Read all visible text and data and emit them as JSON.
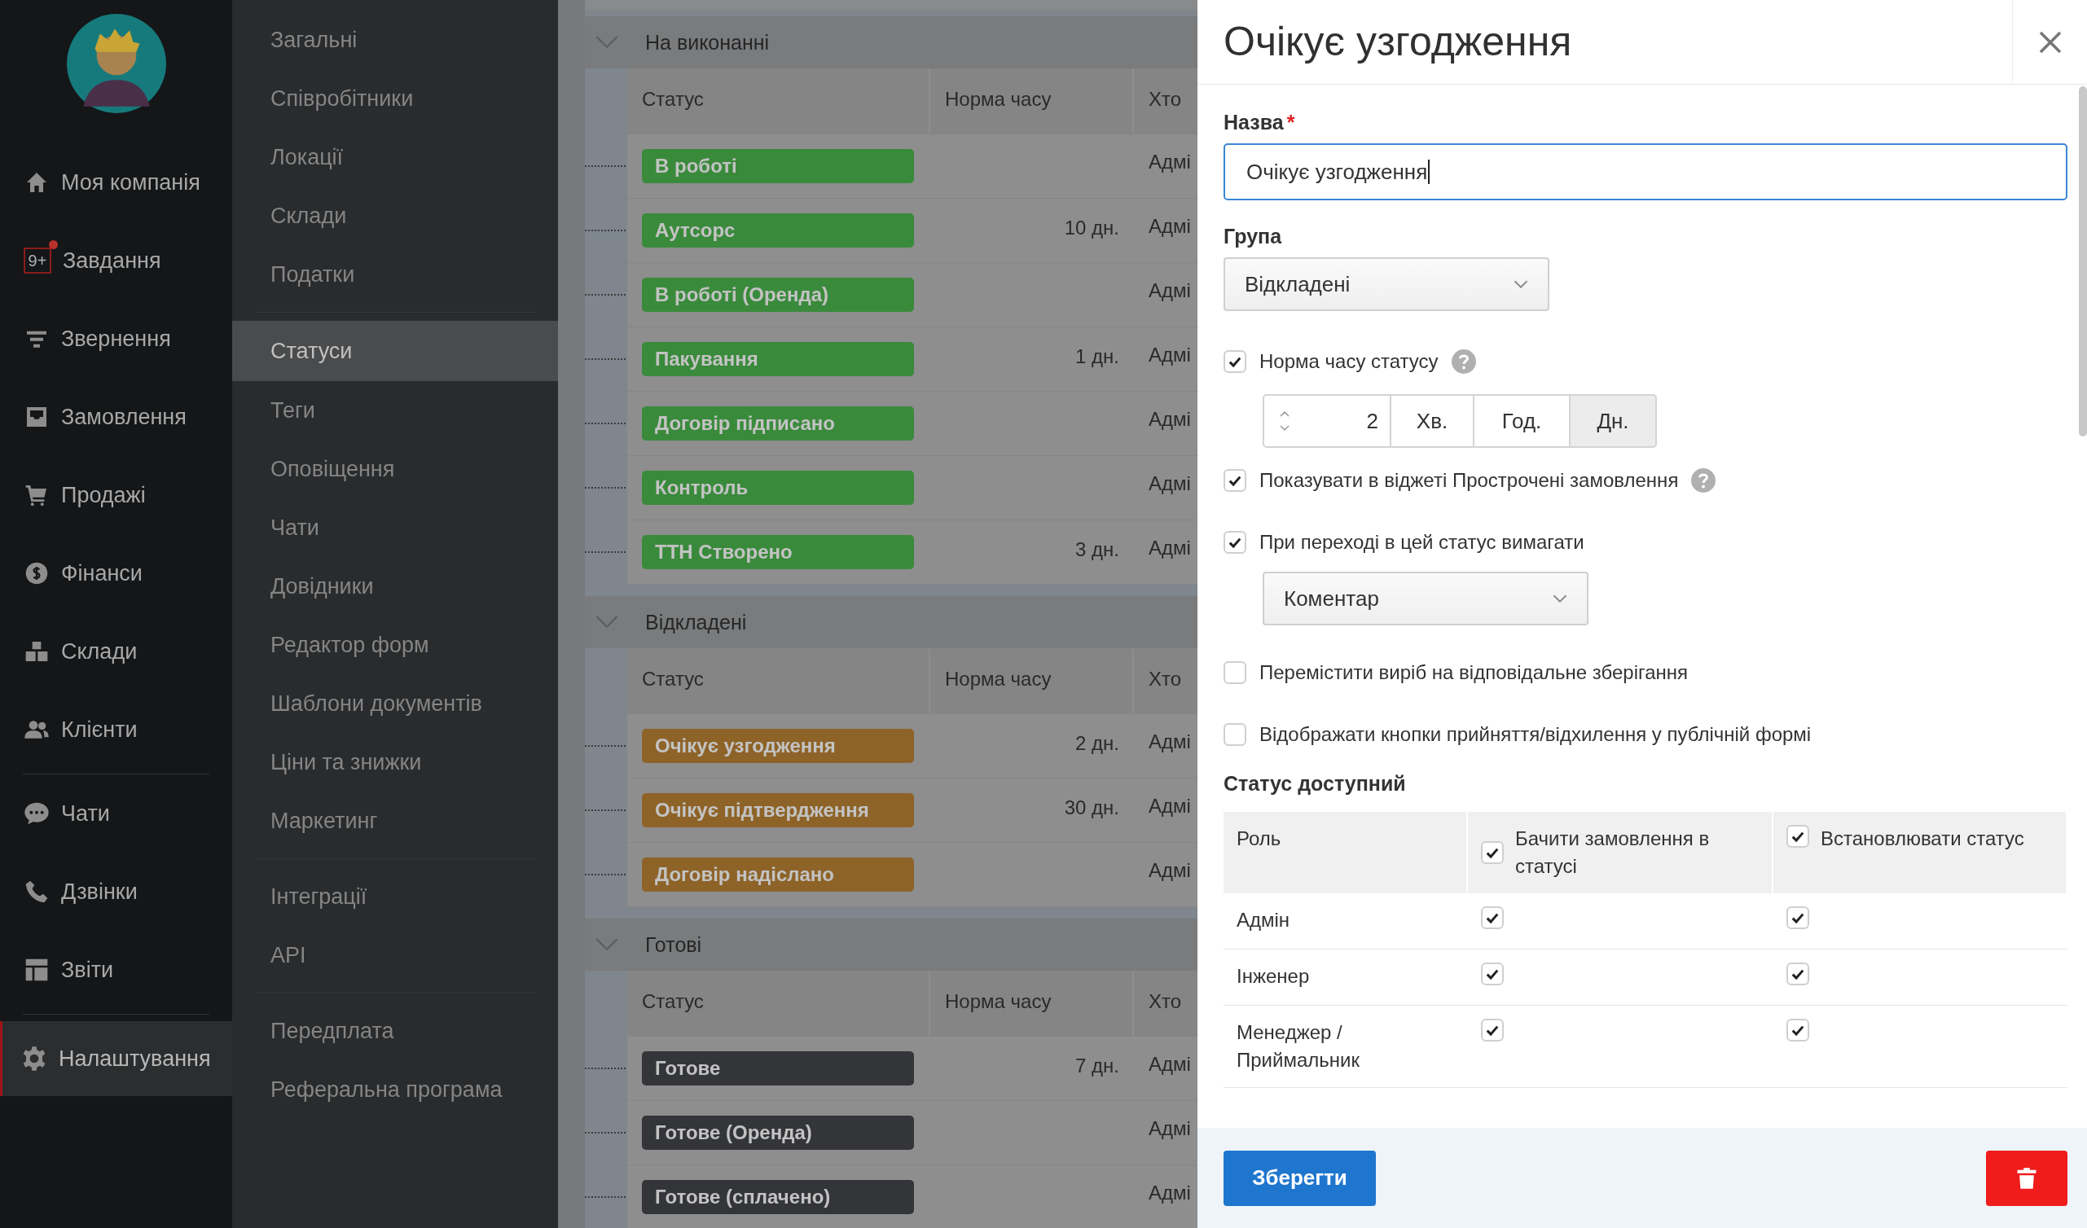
{
  "nav": {
    "groups": [
      [
        {
          "label": "Моя компанія",
          "selected": false
        },
        {
          "label": "Завдання",
          "selected": false,
          "badge": "9+"
        },
        {
          "label": "Звернення",
          "selected": false
        },
        {
          "label": "Замовлення",
          "selected": false
        },
        {
          "label": "Продажі",
          "selected": false
        },
        {
          "label": "Фінанси",
          "selected": false
        },
        {
          "label": "Склади",
          "selected": false
        },
        {
          "label": "Клієнти",
          "selected": false
        }
      ],
      [
        {
          "label": "Чати",
          "selected": false
        },
        {
          "label": "Дзвінки",
          "selected": false
        },
        {
          "label": "Звіти",
          "selected": false
        }
      ],
      [
        {
          "label": "Налаштування",
          "selected": true
        }
      ]
    ]
  },
  "settings_menu": {
    "groups": [
      [
        {
          "label": "Загальні",
          "selected": false
        },
        {
          "label": "Співробітники",
          "selected": false
        },
        {
          "label": "Локації",
          "selected": false
        },
        {
          "label": "Склади",
          "selected": false
        },
        {
          "label": "Податки",
          "selected": false
        }
      ],
      [
        {
          "label": "Статуси",
          "selected": true
        },
        {
          "label": "Теги",
          "selected": false
        },
        {
          "label": "Оповіщення",
          "selected": false
        },
        {
          "label": "Чати",
          "selected": false
        },
        {
          "label": "Довідники",
          "selected": false
        },
        {
          "label": "Редактор форм",
          "selected": false
        },
        {
          "label": "Шаблони документів",
          "selected": false
        },
        {
          "label": "Ціни та знижки",
          "selected": false
        },
        {
          "label": "Маркетинг",
          "selected": false
        }
      ],
      [
        {
          "label": "Інтеграції",
          "selected": false
        },
        {
          "label": "API",
          "selected": false
        }
      ],
      [
        {
          "label": "Передплата",
          "selected": false
        },
        {
          "label": "Реферальна програма",
          "selected": false
        }
      ]
    ]
  },
  "status_groups": [
    {
      "name": "На виконанні",
      "columns": [
        "Статус",
        "Норма часу",
        "Хто"
      ],
      "rows": [
        {
          "status": "В роботі",
          "color": "#3a8a3c",
          "time": "",
          "who": "Адмі"
        },
        {
          "status": "Аутсорс",
          "color": "#3a8a3c",
          "time": "10 дн.",
          "who": "Адмі"
        },
        {
          "status": "В роботі (Оренда)",
          "color": "#3a8a3c",
          "time": "",
          "who": "Адмі"
        },
        {
          "status": "Пакування",
          "color": "#3a8a3c",
          "time": "1 дн.",
          "who": "Адмі"
        },
        {
          "status": "Договір підписано",
          "color": "#3a8a3c",
          "time": "",
          "who": "Адмі"
        },
        {
          "status": "Контроль",
          "color": "#3a8a3c",
          "time": "",
          "who": "Адмі"
        },
        {
          "status": "ТТН Створено",
          "color": "#3a8a3c",
          "time": "3 дн.",
          "who": "Адмі"
        }
      ]
    },
    {
      "name": "Відкладені",
      "columns": [
        "Статус",
        "Норма часу",
        "Хто"
      ],
      "rows": [
        {
          "status": "Очікує узгодження",
          "color": "#8e6328",
          "time": "2 дн.",
          "who": "Адмі"
        },
        {
          "status": "Очікує підтвердження",
          "color": "#8e6328",
          "time": "30 дн.",
          "who": "Адмі"
        },
        {
          "status": "Договір надіслано",
          "color": "#8e6328",
          "time": "",
          "who": "Адмі"
        }
      ]
    },
    {
      "name": "Готові",
      "columns": [
        "Статус",
        "Норма часу",
        "Хто"
      ],
      "rows": [
        {
          "status": "Готове",
          "color": "#333538",
          "time": "7 дн.",
          "who": "Адмі"
        },
        {
          "status": "Готове (Оренда)",
          "color": "#333538",
          "time": "",
          "who": "Адмі"
        },
        {
          "status": "Готове (сплачено)",
          "color": "#333538",
          "time": "",
          "who": "Адмі"
        }
      ]
    }
  ],
  "panel": {
    "title": "Очікує узгодження",
    "name_field": {
      "label": "Назва",
      "required_mark": "*",
      "value": "Очікує узгодження"
    },
    "group_field": {
      "label": "Група",
      "value": "Відкладені"
    },
    "time_norm": {
      "label": "Норма часу статусу",
      "checked": true,
      "value": "2",
      "units": [
        {
          "label": "Хв.",
          "selected": false
        },
        {
          "label": "Год.",
          "selected": false
        },
        {
          "label": "Дн.",
          "selected": true
        }
      ]
    },
    "show_in_widget": {
      "label": "Показувати в віджеті Прострочені замовлення",
      "checked": true
    },
    "require": {
      "label": "При переході в цей статус вимагати",
      "checked": true,
      "value": "Коментар"
    },
    "options": [
      {
        "label": "Перемістити виріб на відповідальне зберігання",
        "checked": false
      },
      {
        "label": "Відображати кнопки прийняття/відхилення у публічній формі",
        "checked": false
      }
    ],
    "access": {
      "title": "Статус доступний",
      "columns": [
        {
          "label": "Роль"
        },
        {
          "label": "Бачити замовлення в статусі",
          "checked": true
        },
        {
          "label": "Встановлювати статус",
          "checked": true
        }
      ],
      "rows": [
        {
          "role": "Адмін",
          "view": true,
          "set": true
        },
        {
          "role": "Інженер",
          "view": true,
          "set": true
        },
        {
          "role": "Менеджер / Приймальник",
          "view": true,
          "set": true
        }
      ]
    },
    "save_label": "Зберегти"
  }
}
